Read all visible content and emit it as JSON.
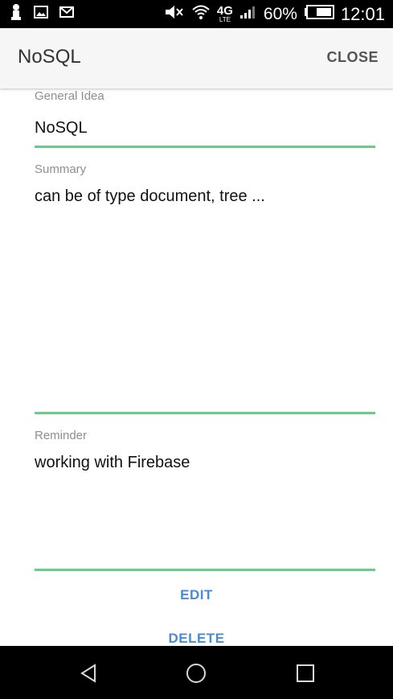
{
  "status_bar": {
    "battery_percent": "60%",
    "time": "12:01",
    "network": "4G",
    "network_sub": "LTE",
    "icons": [
      "notification-icon",
      "image-icon",
      "gmail-icon",
      "mute-icon",
      "wifi-icon",
      "signal-icon",
      "battery-icon"
    ]
  },
  "app_bar": {
    "title": "NoSQL",
    "close_label": "CLOSE"
  },
  "form": {
    "general_idea_label": "General Idea",
    "general_idea_value": "NoSQL",
    "summary_label": "Summary",
    "summary_value": "can be of type document, tree ...",
    "reminder_label": "Reminder",
    "reminder_value": "working with Firebase",
    "underline_color": "#6ccb8c"
  },
  "actions": {
    "edit_label": "EDIT",
    "delete_label": "DELETE",
    "accent_color": "#4a8bd4"
  },
  "nav_bar": {
    "icons": [
      "back-icon",
      "home-icon",
      "recents-icon"
    ]
  }
}
